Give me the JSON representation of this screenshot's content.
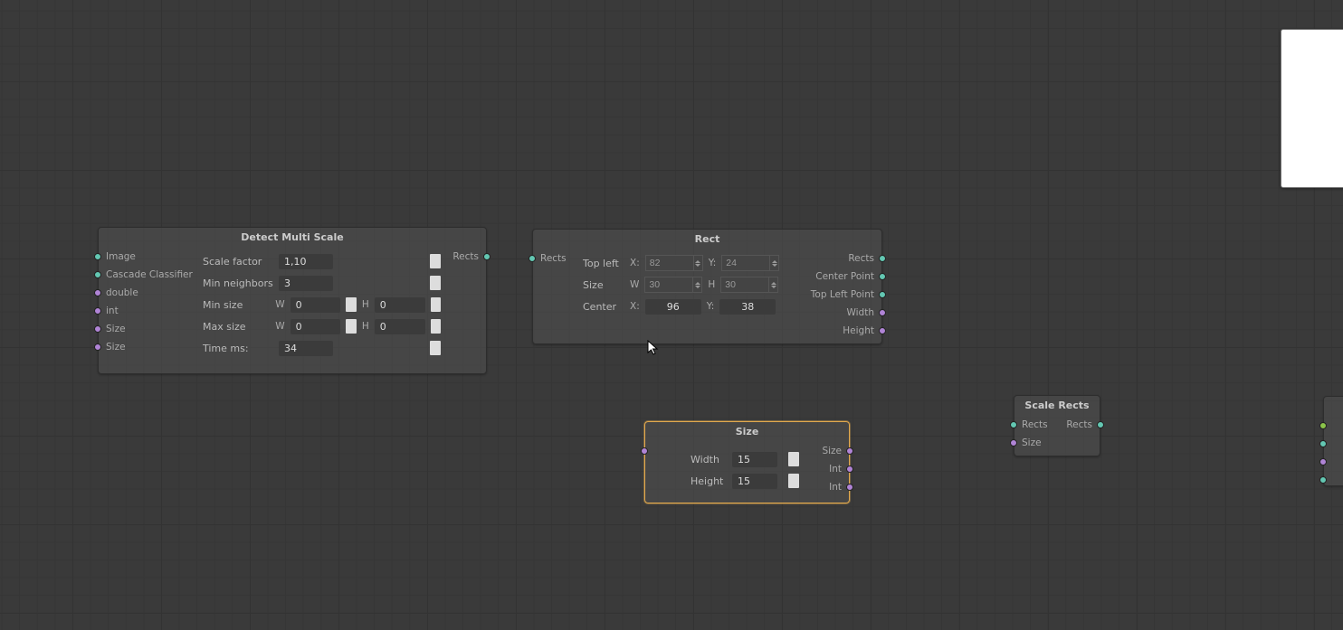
{
  "nodes": {
    "detect": {
      "title": "Detect Multi Scale",
      "inputs": [
        "Image",
        "Cascade Classifier",
        "double",
        "int",
        "Size",
        "Size"
      ],
      "outputs": [
        "Rects"
      ],
      "params": {
        "scale_factor_label": "Scale factor",
        "scale_factor": "1,10",
        "min_neighbors_label": "Min neighbors",
        "min_neighbors": "3",
        "min_size_label": "Min size",
        "min_size_w_label": "W",
        "min_size_w": "0",
        "min_size_h_label": "H",
        "min_size_h": "0",
        "max_size_label": "Max size",
        "max_size_w_label": "W",
        "max_size_w": "0",
        "max_size_h_label": "H",
        "max_size_h": "0",
        "time_label": "Time ms:",
        "time": "34"
      }
    },
    "rect": {
      "title": "Rect",
      "inputs": [
        "Rects"
      ],
      "outputs": [
        "Rects",
        "Center Point",
        "Top Left Point",
        "Width",
        "Height"
      ],
      "params": {
        "topleft_label": "Top left",
        "x_label": "X:",
        "y_label": "Y:",
        "topleft_x": "82",
        "topleft_y": "24",
        "size_label": "Size",
        "w_label": "W",
        "h_label": "H",
        "size_w": "30",
        "size_h": "30",
        "center_label": "Center",
        "center_x": "96",
        "center_y": "38"
      }
    },
    "size": {
      "title": "Size",
      "outputs": [
        "Size",
        "Int",
        "Int"
      ],
      "params": {
        "width_label": "Width",
        "width": "15",
        "height_label": "Height",
        "height": "15"
      }
    },
    "scale_rects": {
      "title": "Scale Rects",
      "inputs": [
        "Rects",
        "Size"
      ],
      "outputs": [
        "Rects"
      ]
    }
  },
  "colors": {
    "wire_green": "#76d6a8",
    "wire_teal": "#63c7b2",
    "accent_selected": "#e2a94e"
  }
}
